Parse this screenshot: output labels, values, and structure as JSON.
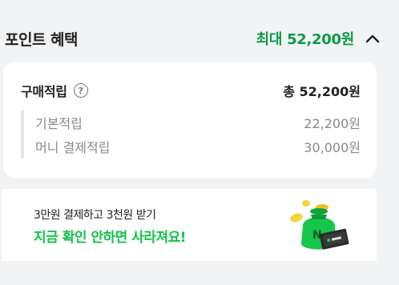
{
  "header": {
    "title": "포인트 혜택",
    "max_benefit": "최대 52,200원",
    "toggle_icon": "chevron-up-icon"
  },
  "summary": {
    "label": "구매적립",
    "help_icon": "question-circle-icon",
    "total": "총 52,200원",
    "items": [
      {
        "label": "기본적립",
        "value": "22,200원"
      },
      {
        "label": "머니 결제적립",
        "value": "30,000원"
      }
    ]
  },
  "banner": {
    "line1": "3만원 결제하고 3천원 받기",
    "line2": "지금 확인 안하면 사라져요!",
    "art": "money-bag-with-pay-card-illustration"
  },
  "colors": {
    "accent_green": "#0b9b46",
    "promo_green": "#12c24a",
    "background": "#f2f3f5"
  }
}
